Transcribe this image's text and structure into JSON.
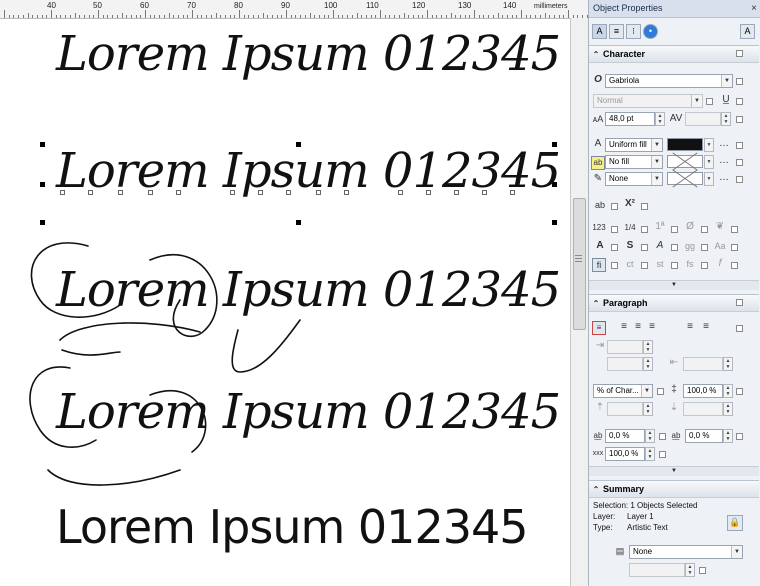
{
  "ruler": {
    "labels": [
      "40",
      "50",
      "60",
      "70",
      "80",
      "90",
      "100",
      "110",
      "120",
      "130",
      "140"
    ],
    "unit": "millimeters"
  },
  "canvas": {
    "texts": [
      "Lorem Ipsum 012345",
      "Lorem Ipsum 012345",
      "Lorem Ipsum 012345",
      "Lorem Ipsum 012345",
      "Lorem Ipsum 012345"
    ]
  },
  "panel": {
    "title": "Object Properties",
    "close": "×",
    "character": {
      "header": "Character",
      "font_name": "Gabriola",
      "font_style": "Normal",
      "font_size": "48,0 pt",
      "fill_type": "Uniform fill",
      "fill_color": "#111111",
      "bg_fill": "No fill",
      "outline": "None"
    },
    "paragraph": {
      "header": "Paragraph",
      "spacing_unit": "% of Char...",
      "line_spacing": "100,0 %",
      "char_spacing": "0,0 %",
      "word_spacing": "0,0 %",
      "lang_spacing": "100,0 %"
    },
    "summary": {
      "header": "Summary",
      "selection": "Selection: 1 Objects Selected",
      "layer_label": "Layer:",
      "layer_value": "Layer 1",
      "type_label": "Type:",
      "type_value": "Artistic Text",
      "wrap": "None"
    }
  },
  "colors": {
    "panel_bg": "#eef1f5",
    "title_bg": "#d7e0ec",
    "text": "#111111"
  }
}
